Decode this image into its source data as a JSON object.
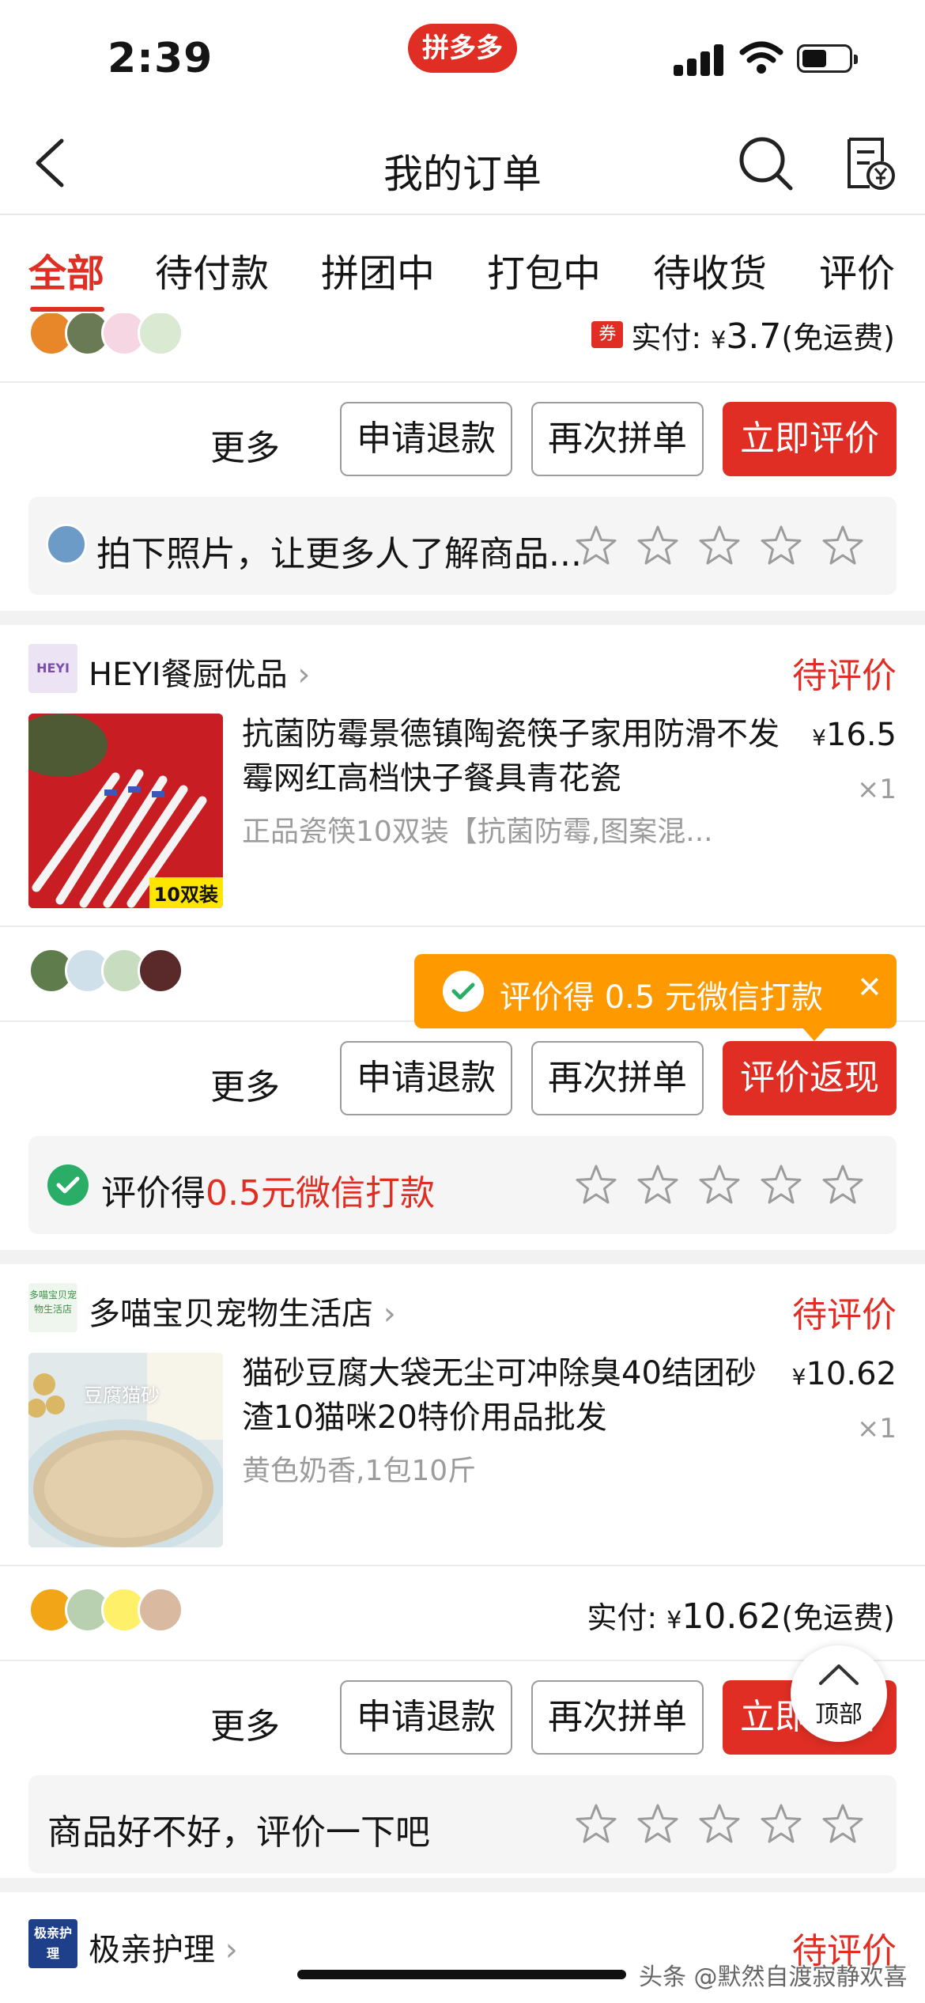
{
  "status_bar": {
    "time": "2:39",
    "app_pill": "拼多多"
  },
  "header": {
    "title": "我的订单"
  },
  "tabs": [
    {
      "label": "全部",
      "active": true
    },
    {
      "label": "待付款"
    },
    {
      "label": "拼团中"
    },
    {
      "label": "打包中"
    },
    {
      "label": "待收货"
    },
    {
      "label": "评价"
    }
  ],
  "orders": [
    {
      "coupon_icon": "券",
      "paid_label": "实付:",
      "currency": "¥",
      "paid_amount": "3.7",
      "shipping_note": "(免运费)",
      "more_label": "更多",
      "buttons": [
        "申请退款",
        "再次拼单",
        "立即评价"
      ],
      "review_prompt": "拍下照片，让更多人了解商品..."
    },
    {
      "shop_logo_text": "HEYI",
      "shop_name": "HEYI餐厨优品",
      "chevron": "›",
      "status": "待评价",
      "product_title": "抗菌防霉景德镇陶瓷筷子家用防滑不发霉网红高档快子餐具青花瓷",
      "product_spec": "正品瓷筷10双装【抗菌防霉,图案混...",
      "thumb_badge": "10双装",
      "currency": "¥",
      "price": "16.5",
      "quantity": "×1",
      "tooltip": "评价得 0.5 元微信打款",
      "tooltip_close": "✕",
      "more_label": "更多",
      "buttons": [
        "申请退款",
        "再次拼单",
        "评价返现"
      ],
      "review_prefix": "评价得",
      "review_highlight": "0.5元微信打款"
    },
    {
      "shop_logo_text": "多喵宝贝宠物生活店",
      "shop_name": "多喵宝贝宠物生活店",
      "chevron": "›",
      "status": "待评价",
      "product_title": "猫砂豆腐大袋无尘可冲除臭40结团砂渣10猫咪20特价用品批发",
      "product_spec": "黄色奶香,1包10斤",
      "thumb_text": "豆腐猫砂",
      "currency": "¥",
      "price": "10.62",
      "quantity": "×1",
      "paid_label": "实付:",
      "paid_amount": "10.62",
      "shipping_note": "(免运费)",
      "more_label": "更多",
      "buttons": [
        "申请退款",
        "再次拼单",
        "立即评价"
      ],
      "review_prompt": "商品好不好，评价一下吧"
    },
    {
      "shop_logo_text": "极亲护理",
      "shop_name": "极亲护理",
      "chevron": "›",
      "status": "待评价"
    }
  ],
  "back_to_top": "顶部",
  "watermark": "头条 @默然自渡寂静欢喜",
  "colors": {
    "brand_red": "#e02e24",
    "tooltip_orange": "#ff9900",
    "wechat_green": "#2aae67",
    "muted": "#9c9c9c"
  }
}
